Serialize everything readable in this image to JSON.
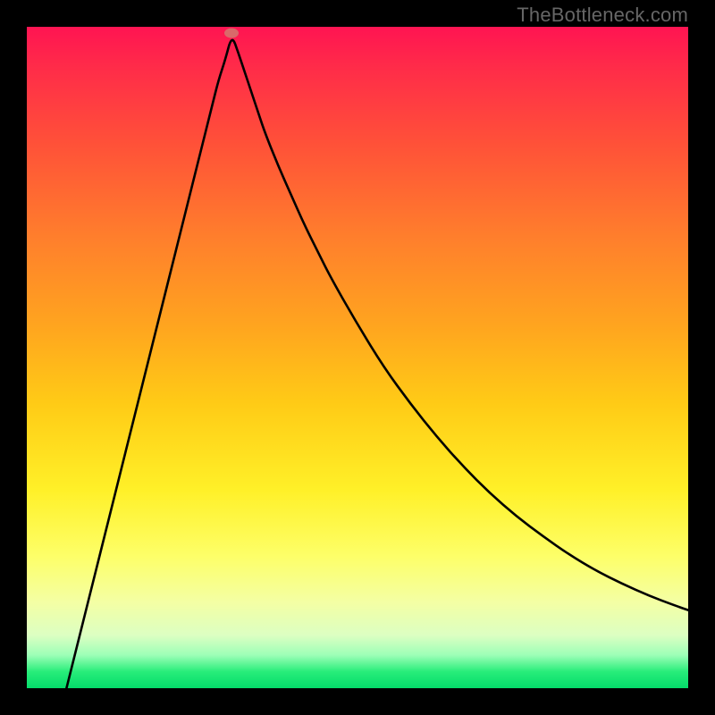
{
  "watermark": "TheBottleneck.com",
  "chart_data": {
    "type": "line",
    "title": "",
    "xlabel": "",
    "ylabel": "",
    "xlim": [
      0,
      100
    ],
    "ylim": [
      0,
      100
    ],
    "grid": false,
    "legend": false,
    "marker": {
      "x_pct": 31,
      "y_pct": 99.0
    },
    "series": [
      {
        "name": "bottleneck-curve",
        "x_pct": [
          6,
          8,
          10,
          12,
          14,
          16,
          18,
          20,
          22,
          24,
          26,
          28,
          29,
          30,
          31,
          32,
          33,
          34,
          35,
          36,
          38,
          40,
          42,
          44,
          46,
          50,
          54,
          58,
          62,
          66,
          70,
          74,
          78,
          82,
          86,
          90,
          94,
          98,
          100
        ],
        "y_pct": [
          0,
          8,
          16,
          24,
          32,
          40,
          48,
          56,
          64,
          72,
          80,
          88,
          92,
          95,
          98.8,
          96,
          93,
          90,
          87,
          84,
          79,
          74.5,
          70,
          66,
          62,
          55,
          48.5,
          43,
          38,
          33.5,
          29.5,
          26,
          23,
          20.2,
          17.8,
          15.8,
          14,
          12.5,
          11.8
        ]
      }
    ],
    "background_gradient": {
      "top": "#ff1452",
      "mid_upper": "#ffa41f",
      "mid": "#fff028",
      "mid_lower": "#f4ffa4",
      "bottom": "#04dc6a"
    }
  }
}
